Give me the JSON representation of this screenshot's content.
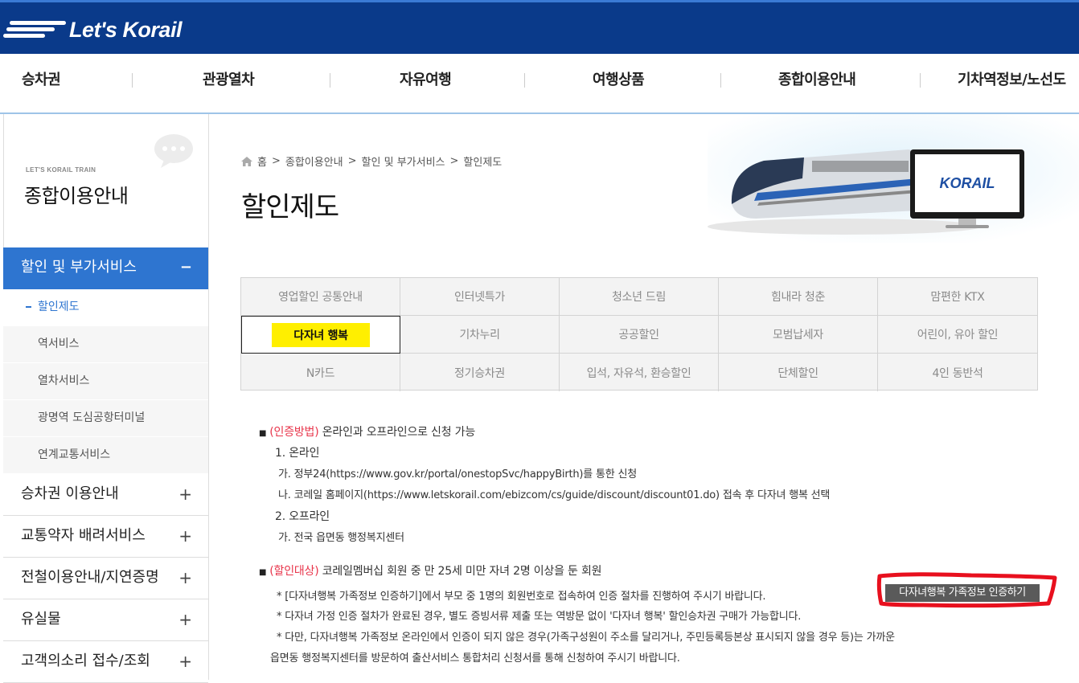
{
  "header": {
    "logo_text": "Let's Korail",
    "nav": [
      "승차권",
      "관광열차",
      "자유여행",
      "여행상품",
      "종합이용안내",
      "기차역정보/노선도"
    ]
  },
  "sidebar": {
    "subtitle": "LET'S KORAIL TRAIN",
    "title": "종합이용안내",
    "active_menu": "할인 및 부가서비스",
    "active_toggle": "−",
    "submenu": [
      "할인제도",
      "역서비스",
      "열차서비스",
      "광명역 도심공항터미널",
      "연계교통서비스"
    ],
    "menus": [
      "승차권 이용안내",
      "교통약자 배려서비스",
      "전철이용안내/지연증명",
      "유실물",
      "고객의소리 접수/조회"
    ],
    "toggle": "+"
  },
  "breadcrumb": {
    "home": "홈",
    "items": [
      "종합이용안내",
      "할인 및 부가서비스",
      "할인제도"
    ],
    "sep": ">"
  },
  "page_title": "할인제도",
  "hero": {
    "monitor_brand": "KORAIL"
  },
  "tabs": [
    "영업할인 공통안내",
    "인터넷특가",
    "청소년 드림",
    "힘내라 청춘",
    "맘편한 KTX",
    "다자녀 행복",
    "기차누리",
    "공공할인",
    "모범납세자",
    "어린이, 유아 할인",
    "N카드",
    "정기승차권",
    "입석, 자유석, 환승할인",
    "단체할인",
    "4인 동반석"
  ],
  "active_tab": "다자녀 행복",
  "body": {
    "method_label": "(인증방법)",
    "method_text": " 온라인과 오프라인으로 신청 가능",
    "online": "1. 온라인",
    "online_a": "가. 정부24(https://www.gov.kr/portal/onestopSvc/happyBirth)를 통한 신청",
    "online_b": "나. 코레일 홈페이지(https://www.letskorail.com/ebizcom/cs/guide/discount/discount01.do) 접속 후 다자녀 행복 선택",
    "offline": "2. 오프라인",
    "offline_a": "가. 전국 읍면동 행정복지센터",
    "target_label": "(할인대상)",
    "target_text": " 코레일멤버십 회원 중 만 25세 미만 자녀 2명 이상을 둔 회원",
    "note1": "* [다자녀행복 가족정보 인증하기]에서 부모 중 1명의 회원번호로 접속하여 인증 절차를 진행하여 주시기 바랍니다.",
    "note2": "* 다자녀 가정 인증 절차가 완료된 경우, 별도 증빙서류 제출 또는 역방문 없이 '다자녀 행복' 할인승차권 구매가 가능합니다.",
    "note3": "* 다만, 다자녀행복 가족정보 온라인에서 인증이 되지 않은 경우(가족구성원이 주소를 달리거나, 주민등록등본상 표시되지 않을 경우 등)는 가까운",
    "note3b": "읍면동 행정복지센터를 방문하여 출산서비스 통합처리 신청서를 통해 신청하여 주시기 바랍니다.",
    "cert_button": "다자녀행복 가족정보 인증하기"
  },
  "colors": {
    "header_bg": "#0a3a8a",
    "active_menu_bg": "#2e75d0",
    "highlight": "#ffef00",
    "label_red": "#e8344a",
    "annotation_red": "#e8101e"
  }
}
